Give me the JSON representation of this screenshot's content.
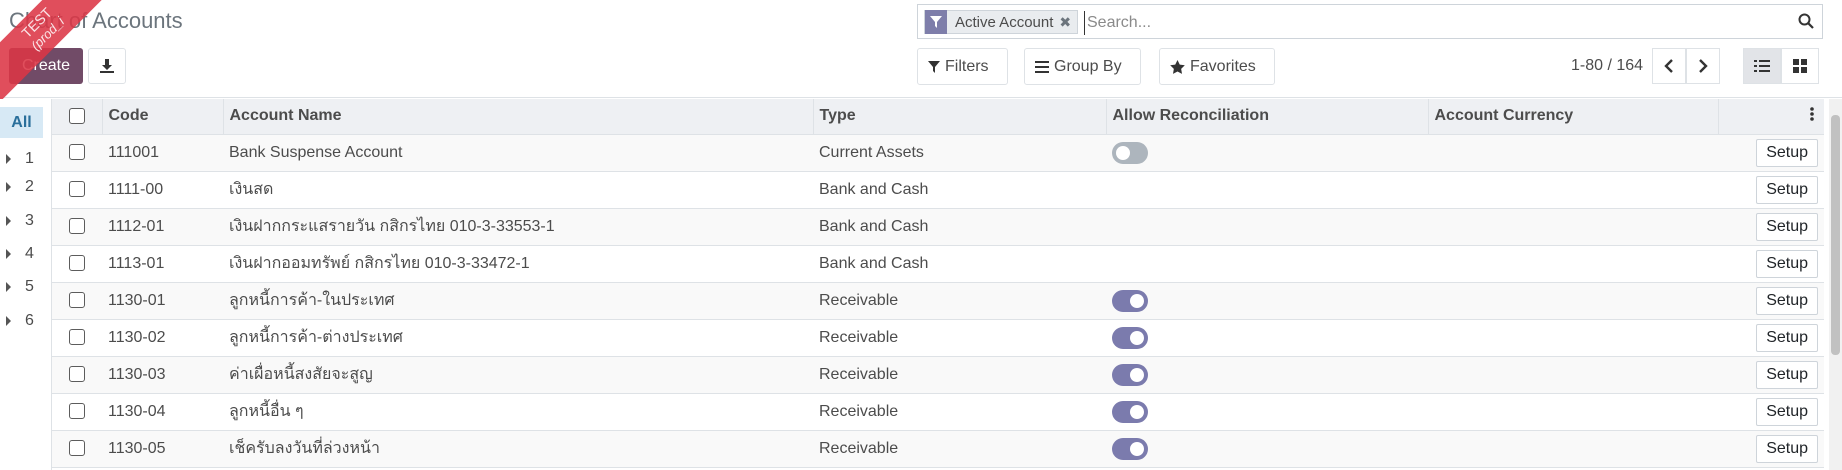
{
  "header": {
    "title": "Chart of Accounts",
    "create_label": "Create",
    "ribbon_text": "TEST",
    "ribbon_sub": "(prod_i"
  },
  "search": {
    "facet_label": "Active Account",
    "placeholder": "Search..."
  },
  "controls": {
    "filters_label": "Filters",
    "groupby_label": "Group By",
    "favorites_label": "Favorites"
  },
  "pager": {
    "value": "1-80 / 164"
  },
  "sidepanel": {
    "all_label": "All",
    "items": [
      "1",
      "2",
      "3",
      "4",
      "5",
      "6"
    ]
  },
  "table": {
    "columns": [
      "Code",
      "Account Name",
      "Type",
      "Allow Reconciliation",
      "Account Currency"
    ],
    "setup_label": "Setup",
    "rows": [
      {
        "code": "111001",
        "name": "Bank Suspense Account",
        "type": "Current Assets",
        "reconcile": "off",
        "currency": ""
      },
      {
        "code": "1111-00",
        "name": "เงินสด",
        "type": "Bank and Cash",
        "reconcile": "none",
        "currency": ""
      },
      {
        "code": "1112-01",
        "name": "เงินฝากกระแสรายวัน กสิกรไทย 010-3-33553-1",
        "type": "Bank and Cash",
        "reconcile": "none",
        "currency": ""
      },
      {
        "code": "1113-01",
        "name": "เงินฝากออมทรัพย์ กสิกรไทย 010-3-33472-1",
        "type": "Bank and Cash",
        "reconcile": "none",
        "currency": ""
      },
      {
        "code": "1130-01",
        "name": "ลูกหนี้การค้า-ในประเทศ",
        "type": "Receivable",
        "reconcile": "on",
        "currency": ""
      },
      {
        "code": "1130-02",
        "name": "ลูกหนี้การค้า-ต่างประเทศ",
        "type": "Receivable",
        "reconcile": "on",
        "currency": ""
      },
      {
        "code": "1130-03",
        "name": "ค่าเผื่อหนี้สงสัยจะสูญ",
        "type": "Receivable",
        "reconcile": "on",
        "currency": ""
      },
      {
        "code": "1130-04",
        "name": "ลูกหนี้อื่น ๆ",
        "type": "Receivable",
        "reconcile": "on",
        "currency": ""
      },
      {
        "code": "1130-05",
        "name": "เช็ครับลงวันที่ล่วงหน้า",
        "type": "Receivable",
        "reconcile": "on",
        "currency": ""
      }
    ]
  },
  "colors": {
    "primary": "#714b67",
    "toggle_on": "#7b7bad",
    "toggle_off": "#adb5bd",
    "facet_icon_bg": "#7e7eaa",
    "side_active_bg": "#d7e9f5"
  },
  "icons": {
    "download": "download-icon",
    "filter": "filter-icon",
    "search": "search-icon",
    "group_by": "bars-icon",
    "favorites": "star-icon",
    "prev": "chevron-left-icon",
    "next": "chevron-right-icon",
    "list_view": "list-view-icon",
    "kanban_view": "kanban-view-icon",
    "optional_columns": "vertical-dots-icon"
  }
}
